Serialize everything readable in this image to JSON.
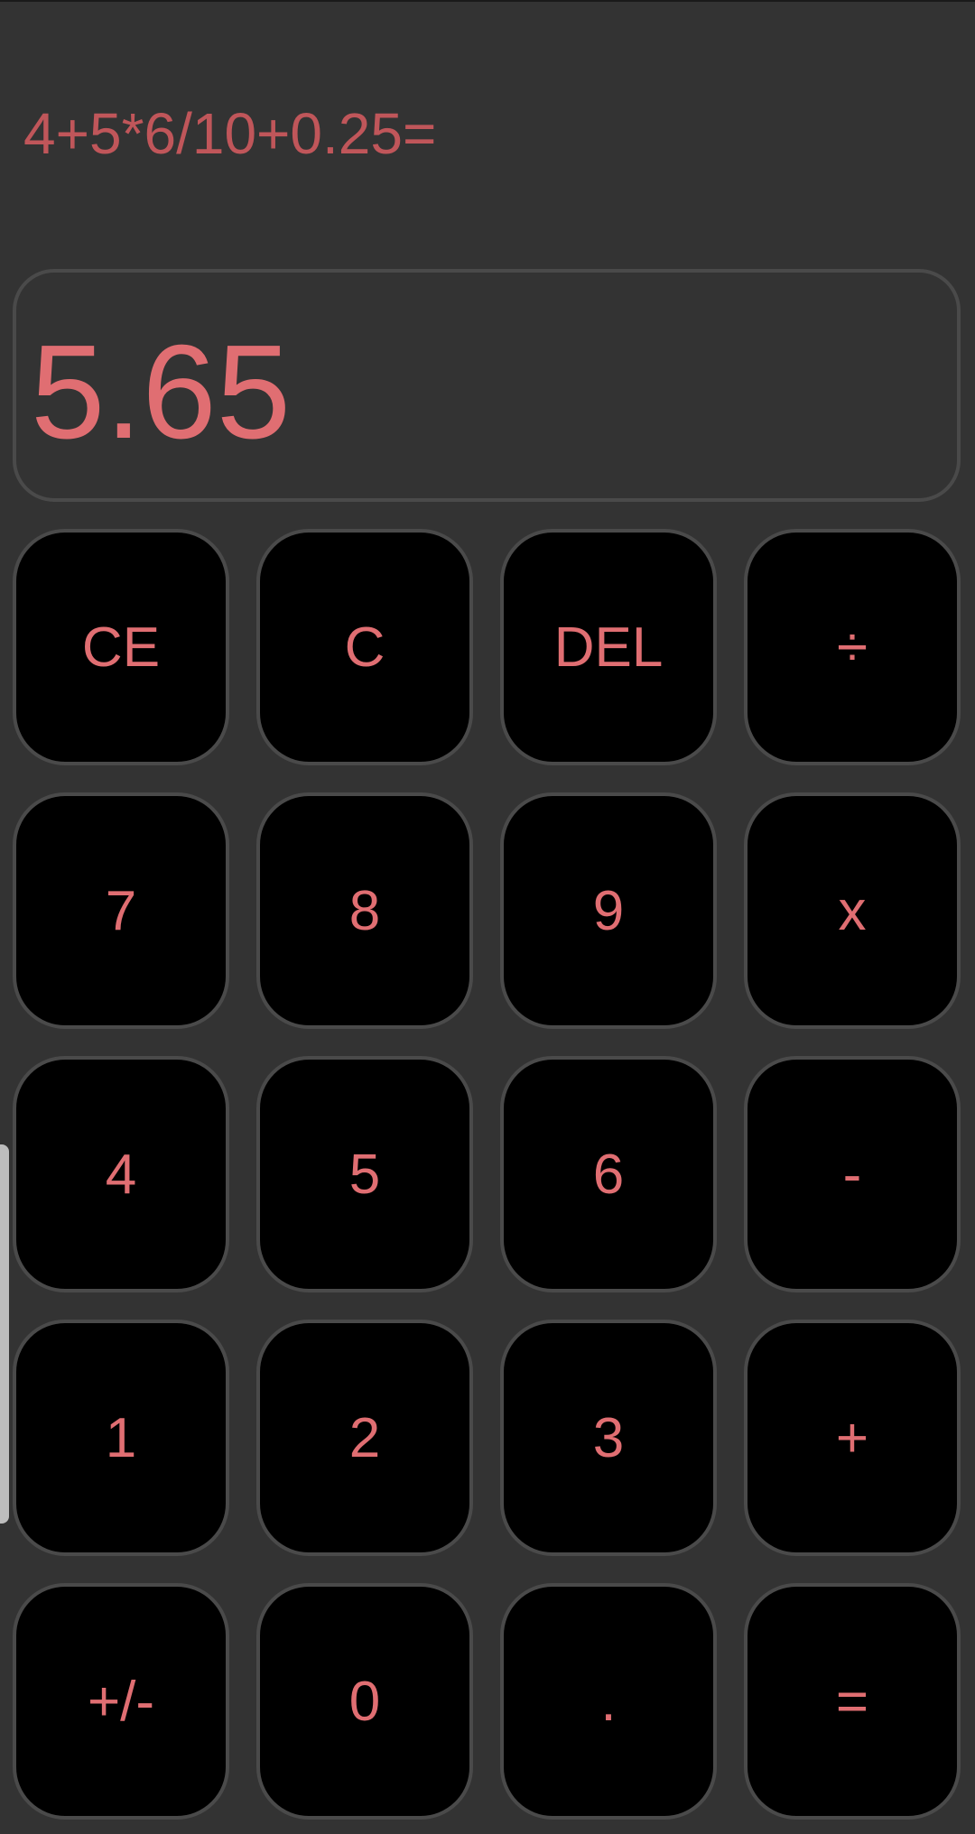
{
  "calculator": {
    "expression": "4+5*6/10+0.25=",
    "result": "5.65",
    "keys": [
      {
        "label": "CE",
        "name": "clear-entry-button"
      },
      {
        "label": "C",
        "name": "clear-button"
      },
      {
        "label": "DEL",
        "name": "delete-button"
      },
      {
        "label": "÷",
        "name": "divide-button"
      },
      {
        "label": "7",
        "name": "digit-7-button"
      },
      {
        "label": "8",
        "name": "digit-8-button"
      },
      {
        "label": "9",
        "name": "digit-9-button"
      },
      {
        "label": "x",
        "name": "multiply-button"
      },
      {
        "label": "4",
        "name": "digit-4-button"
      },
      {
        "label": "5",
        "name": "digit-5-button"
      },
      {
        "label": "6",
        "name": "digit-6-button"
      },
      {
        "label": "-",
        "name": "subtract-button"
      },
      {
        "label": "1",
        "name": "digit-1-button"
      },
      {
        "label": "2",
        "name": "digit-2-button"
      },
      {
        "label": "3",
        "name": "digit-3-button"
      },
      {
        "label": "+",
        "name": "add-button"
      },
      {
        "label": "+/-",
        "name": "negate-button"
      },
      {
        "label": "0",
        "name": "digit-0-button"
      },
      {
        "label": ".",
        "name": "decimal-point-button"
      },
      {
        "label": "=",
        "name": "equals-button"
      }
    ]
  },
  "colors": {
    "background": "#333333",
    "key_background": "#000000",
    "key_border": "#4a4a4a",
    "text_accent": "#e06e72",
    "expression_text": "#c0565a"
  }
}
